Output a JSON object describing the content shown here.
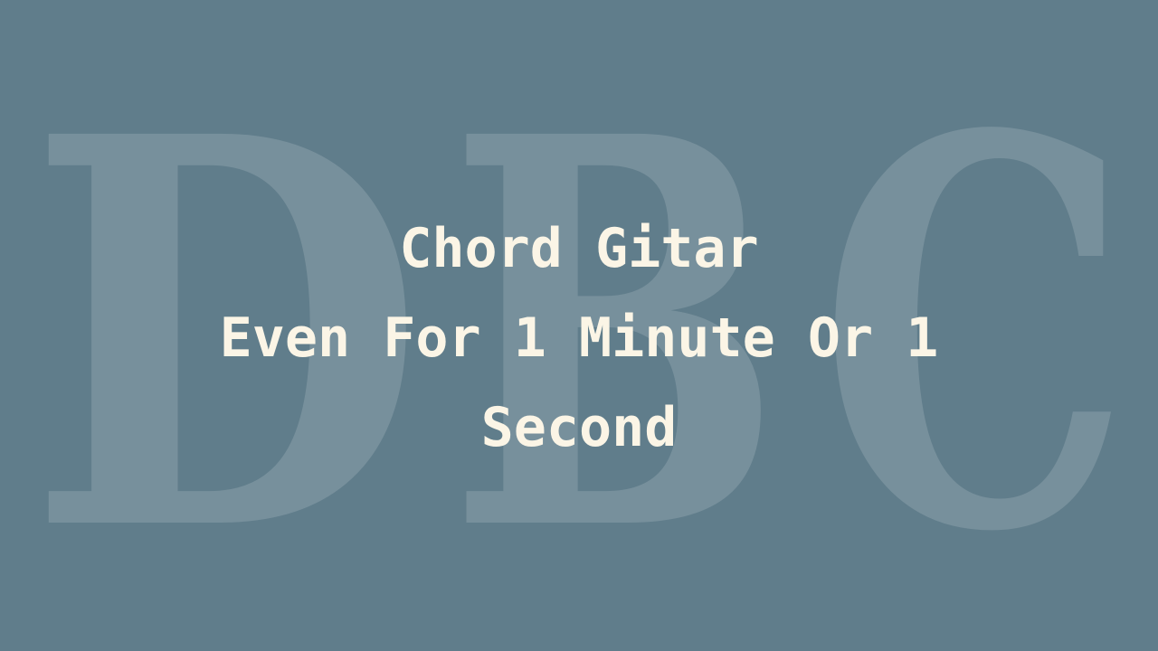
{
  "background_color": "#607d8b",
  "watermark": {
    "text": "DBC",
    "letters": [
      "D",
      "B",
      "C"
    ]
  },
  "title": {
    "lines": [
      "Chord Gitar",
      "Even For 1 Minute Or 1",
      "Second"
    ],
    "color": "#fbf5e6"
  }
}
